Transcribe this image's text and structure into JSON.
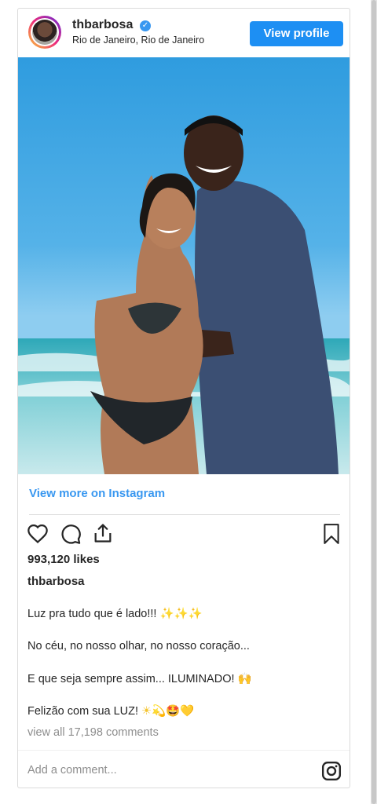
{
  "post": {
    "username": "thbarbosa",
    "location": "Rio de Janeiro, Rio de Janeiro",
    "view_profile_label": "View profile",
    "view_more_label": "View more on Instagram",
    "likes": "993,120 likes",
    "author": "thbarbosa",
    "caption_lines": [
      {
        "text": "Luz pra tudo que é lado!!! ",
        "emoji": "✨✨✨"
      },
      {
        "text": "No céu, no nosso olhar, no nosso coração...",
        "emoji": ""
      },
      {
        "text": "E que seja sempre assim... ILUMINADO! ",
        "emoji": "🙌"
      },
      {
        "text": "Felizão com sua LUZ! ",
        "emoji": "☀💫🤩💛"
      }
    ],
    "comments_link": "view all 17,198 comments",
    "comment_placeholder": "Add a comment..."
  },
  "icons": {
    "like": "heart-icon",
    "comment": "comment-icon",
    "share": "share-icon",
    "save": "bookmark-icon",
    "instagram": "instagram-icon",
    "verified": "verified-badge-icon"
  },
  "colors": {
    "accent": "#3897f0",
    "button": "#1d8ff3"
  }
}
